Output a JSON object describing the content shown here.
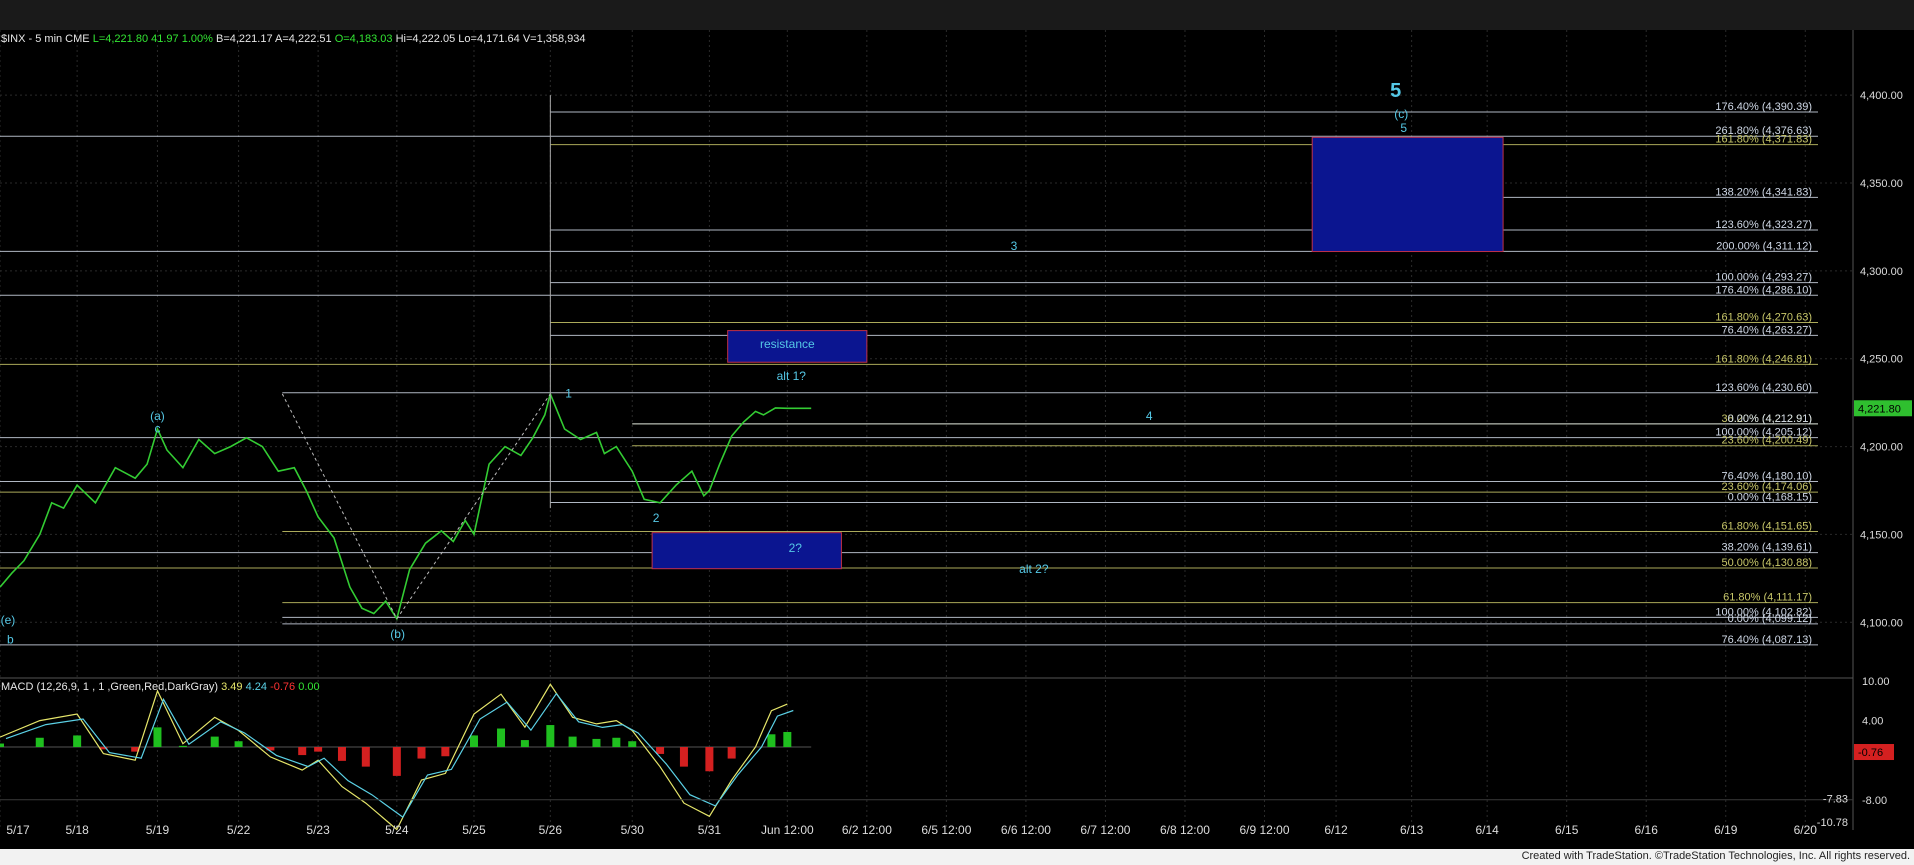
{
  "header": {
    "symbol": "$INX - 5 min  CME",
    "last": "L=4,221.80",
    "change": "41.97",
    "change_pct": "1.00%",
    "bid": "B=4,221.17",
    "ask": "A=4,222.51",
    "open": "O=4,183.03",
    "high": "Hi=4,222.05",
    "low": "Lo=4,171.64",
    "volume": "V=1,358,934"
  },
  "macd_header": {
    "label": "MACD (12,26,9, 1 , 1 ,Green,Red,DarkGray)",
    "v1": "3.49",
    "v2": "4.24",
    "v3": "-0.76",
    "v4": "0.00"
  },
  "footer": "Created with TradeStation. ©TradeStation Technologies, Inc. All rights reserved.",
  "colors": {
    "background": "#000000",
    "price": "#33cc33",
    "fib_white": "#cfd8e6",
    "fib_yellow": "#c9c86a",
    "label_cyan": "#55c8e6",
    "box": "#0b1590",
    "box_red": "#c0304a"
  },
  "chart_data": {
    "type": "line",
    "title": "$INX - 5 min",
    "y_axis": {
      "min": 4070,
      "max": 4420,
      "ticks": [
        4100,
        4150,
        4200,
        4250,
        4300,
        4350,
        4400
      ],
      "tick_labels": [
        "4,100.00",
        "4,150.00",
        "4,200.00",
        "4,250.00",
        "4,300.00",
        "4,350.00",
        "4,400.00"
      ]
    },
    "last_price": {
      "value": 4221.8,
      "label": "4,221.80"
    },
    "x_axis": {
      "labels": [
        "5/17",
        "5/18",
        "5/19",
        "5/22",
        "5/23",
        "5/24",
        "5/25",
        "5/26",
        "5/30",
        "5/31",
        "Jun 12:00",
        "6/2 12:00",
        "6/5 12:00",
        "6/6 12:00",
        "6/7 12:00",
        "6/8 12:00",
        "6/9 12:00",
        "6/12",
        "6/13",
        "6/14",
        "6/15",
        "6/16",
        "6/19",
        "6/20"
      ],
      "positions": [
        0,
        0.97,
        1.98,
        3.0,
        4.0,
        4.99,
        5.96,
        6.92,
        7.95,
        8.92,
        9.9,
        10.9,
        11.9,
        12.9,
        13.9,
        14.9,
        15.9,
        16.8,
        17.75,
        18.7,
        19.7,
        20.7,
        21.7,
        22.7
      ],
      "range": [
        0,
        23.3
      ]
    },
    "series": [
      {
        "name": "$INX",
        "x": [
          0,
          0.15,
          0.3,
          0.5,
          0.65,
          0.8,
          0.97,
          1.2,
          1.45,
          1.7,
          1.85,
          1.98,
          2.1,
          2.3,
          2.5,
          2.7,
          2.9,
          3.1,
          3.3,
          3.5,
          3.7,
          3.85,
          4.0,
          4.2,
          4.4,
          4.55,
          4.7,
          4.85,
          4.99,
          5.15,
          5.35,
          5.55,
          5.7,
          5.85,
          5.96,
          6.15,
          6.35,
          6.55,
          6.7,
          6.85,
          6.92,
          7.1,
          7.3,
          7.5,
          7.6,
          7.75,
          7.95,
          8.1,
          8.3,
          8.5,
          8.7,
          8.85,
          8.92,
          9.05,
          9.2,
          9.35,
          9.5,
          9.6,
          9.75,
          9.9,
          10.05,
          10.2
        ],
        "y": [
          4120,
          4128,
          4135,
          4150,
          4168,
          4165,
          4178,
          4168,
          4188,
          4182,
          4190,
          4210,
          4198,
          4188,
          4204,
          4196,
          4200,
          4205,
          4200,
          4186,
          4188,
          4175,
          4160,
          4148,
          4120,
          4108,
          4105,
          4112,
          4102,
          4130,
          4145,
          4152,
          4146,
          4158,
          4150,
          4190,
          4200,
          4195,
          4205,
          4218,
          4230,
          4210,
          4204,
          4208,
          4196,
          4200,
          4186,
          4170,
          4168,
          4178,
          4186,
          4172,
          4175,
          4190,
          4206,
          4214,
          4220,
          4218,
          4222,
          4221.8,
          4221.8,
          4221.8
        ]
      },
      {
        "name": "MACD",
        "x": [
          0,
          0.5,
          0.97,
          1.3,
          1.7,
          1.98,
          2.3,
          2.7,
          3.0,
          3.4,
          3.8,
          4.0,
          4.3,
          4.6,
          4.99,
          5.3,
          5.6,
          5.96,
          6.3,
          6.6,
          6.92,
          7.2,
          7.5,
          7.75,
          7.95,
          8.3,
          8.6,
          8.92,
          9.2,
          9.5,
          9.7,
          9.9
        ],
        "y": [
          1.5,
          4.0,
          5.0,
          -1.0,
          -2.0,
          8.5,
          0.5,
          4.5,
          2.5,
          -1.5,
          -3.5,
          -2.0,
          -6.0,
          -8.5,
          -12.5,
          -5.0,
          -4.0,
          5.0,
          8.0,
          3.0,
          9.5,
          4.5,
          3.5,
          4.0,
          2.5,
          -3.0,
          -8.5,
          -10.5,
          -5.0,
          0,
          5.5,
          6.5
        ]
      }
    ],
    "macd_axis": {
      "ticks": [
        10.0,
        4.0,
        -8.0
      ],
      "tick_labels": [
        "10.00",
        "4.00",
        "-8.00"
      ],
      "markers": [
        "-0.76",
        "-7.83",
        "-10.78"
      ]
    },
    "fib_levels": [
      {
        "label": "176.40% (4,390.39)",
        "value": 4390.39,
        "color": "white",
        "x0": 6.92
      },
      {
        "label": "261.80% (4,376.63)",
        "value": 4376.63,
        "color": "white",
        "x0": 0
      },
      {
        "label": "161.80% (4,371.83)",
        "value": 4371.83,
        "color": "yellow",
        "x0": 6.92
      },
      {
        "label": "138.20% (4,341.83)",
        "value": 4341.83,
        "color": "white",
        "x0": 17.7
      },
      {
        "label": "123.60% (4,323.27)",
        "value": 4323.27,
        "color": "white",
        "x0": 6.92
      },
      {
        "label": "200.00% (4,311.12)",
        "value": 4311.12,
        "color": "white",
        "x0": 0
      },
      {
        "label": "100.00% (4,293.27)",
        "value": 4293.27,
        "color": "white",
        "x0": 6.92
      },
      {
        "label": "176.40% (4,286.10)",
        "value": 4286.1,
        "color": "white",
        "x0": 0
      },
      {
        "label": "161.80% (4,270.63)",
        "value": 4270.63,
        "color": "yellow",
        "x0": 6.92
      },
      {
        "label": "76.40% (4,263.27)",
        "value": 4263.27,
        "color": "white",
        "x0": 6.92
      },
      {
        "label": "161.80% (4,246.81)",
        "value": 4246.81,
        "color": "yellow",
        "x0": 0
      },
      {
        "label": "123.60% (4,230.60)",
        "value": 4230.6,
        "color": "white",
        "x0": 3.55
      },
      {
        "label": "38.20% (4,212.91)",
        "value": 4212.91,
        "color": "yellow",
        "x0": 7.95
      },
      {
        "label": "0.00% (4,212.91)",
        "value": 4212.91,
        "color": "white",
        "x0": 7.95
      },
      {
        "label": "100.00% (4,205.12)",
        "value": 4205.12,
        "color": "white",
        "x0": 0
      },
      {
        "label": "23.60% (4,200.49)",
        "value": 4200.49,
        "color": "yellow",
        "x0": 7.95
      },
      {
        "label": "76.40% (4,180.10)",
        "value": 4180.1,
        "color": "white",
        "x0": 0
      },
      {
        "label": "23.60% (4,174.06)",
        "value": 4174.06,
        "color": "yellow",
        "x0": 0
      },
      {
        "label": "0.00% (4,168.15)",
        "value": 4168.15,
        "color": "white",
        "x0": 6.92
      },
      {
        "label": "61.80% (4,151.65)",
        "value": 4151.65,
        "color": "yellow",
        "x0": 3.55
      },
      {
        "label": "38.20% (4,139.61)",
        "value": 4139.61,
        "color": "white",
        "x0": 0
      },
      {
        "label": "50.00% (4,130.88)",
        "value": 4130.88,
        "color": "yellow",
        "x0": 0
      },
      {
        "label": "61.80% (4,111.17)",
        "value": 4111.17,
        "color": "yellow",
        "x0": 3.55
      },
      {
        "label": "100.00% (4,102.82)",
        "value": 4102.82,
        "color": "white",
        "x0": 3.55
      },
      {
        "label": "0.00% (4,099.12)",
        "value": 4099.12,
        "color": "white",
        "x0": 3.55
      },
      {
        "label": "76.40% (4,087.13)",
        "value": 4087.13,
        "color": "white",
        "x0": 0
      }
    ],
    "boxes": [
      {
        "name": "resistance-box",
        "x0": 9.15,
        "x1": 10.9,
        "y0": 4248,
        "y1": 4266,
        "border": "red",
        "label": "resistance"
      },
      {
        "name": "alt2-box",
        "x0": 8.2,
        "x1": 10.58,
        "y0": 4130.5,
        "y1": 4151,
        "border": "red",
        "label": ""
      },
      {
        "name": "target-box",
        "x0": 16.5,
        "x1": 18.9,
        "y0": 4311,
        "y1": 4376,
        "border": "red",
        "label": ""
      }
    ],
    "annotations": [
      {
        "text": "5",
        "x": 17.55,
        "y": 4399,
        "size": "big"
      },
      {
        "text": "(c)",
        "x": 17.62,
        "y": 4387,
        "size": "small"
      },
      {
        "text": "5",
        "x": 17.65,
        "y": 4379,
        "size": "small"
      },
      {
        "text": "3",
        "x": 12.75,
        "y": 4312,
        "size": "small"
      },
      {
        "text": "resistance",
        "x": 9.9,
        "y": 4256,
        "size": "small"
      },
      {
        "text": "alt 1?",
        "x": 9.95,
        "y": 4238,
        "size": "small"
      },
      {
        "text": "1",
        "x": 7.15,
        "y": 4228,
        "size": "small"
      },
      {
        "text": "4",
        "x": 14.45,
        "y": 4215,
        "size": "small"
      },
      {
        "text": "(a)",
        "x": 1.98,
        "y": 4215,
        "size": "small"
      },
      {
        "text": "c",
        "x": 1.98,
        "y": 4208,
        "size": "small"
      },
      {
        "text": "2",
        "x": 8.25,
        "y": 4157,
        "size": "small"
      },
      {
        "text": "2?",
        "x": 10.0,
        "y": 4140,
        "size": "small"
      },
      {
        "text": "alt 2?",
        "x": 13.0,
        "y": 4128,
        "size": "small"
      },
      {
        "text": "(e)",
        "x": 0.1,
        "y": 4099,
        "size": "small"
      },
      {
        "text": "b",
        "x": 0.13,
        "y": 4088,
        "size": "small"
      },
      {
        "text": "(b)",
        "x": 5.0,
        "y": 4091,
        "size": "small"
      }
    ],
    "grid": true
  }
}
